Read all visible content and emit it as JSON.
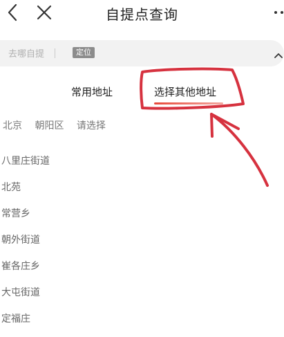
{
  "header": {
    "title": "自提点查询",
    "back_icon": "chevron-left-icon",
    "close_icon": "close-icon",
    "more_icon": "more-dots-icon"
  },
  "search": {
    "placeholder": "去哪自提",
    "divider_text": "|",
    "locate_label": "定位",
    "collapse_icon": "chevron-up-icon"
  },
  "tabs": [
    {
      "label": "常用地址",
      "active": false
    },
    {
      "label": "选择其他地址",
      "active": true
    }
  ],
  "breadcrumb": {
    "city": "北京",
    "district": "朝阳区",
    "prompt": "请选择"
  },
  "districts": [
    {
      "label": "八里庄街道"
    },
    {
      "label": "北苑"
    },
    {
      "label": "常营乡"
    },
    {
      "label": "朝外街道"
    },
    {
      "label": "崔各庄乡"
    },
    {
      "label": "大屯街道"
    },
    {
      "label": "定福庄"
    }
  ],
  "colors": {
    "accent": "#e8493a",
    "annotation": "#d6323f",
    "search_bg": "#f2f2f2"
  }
}
